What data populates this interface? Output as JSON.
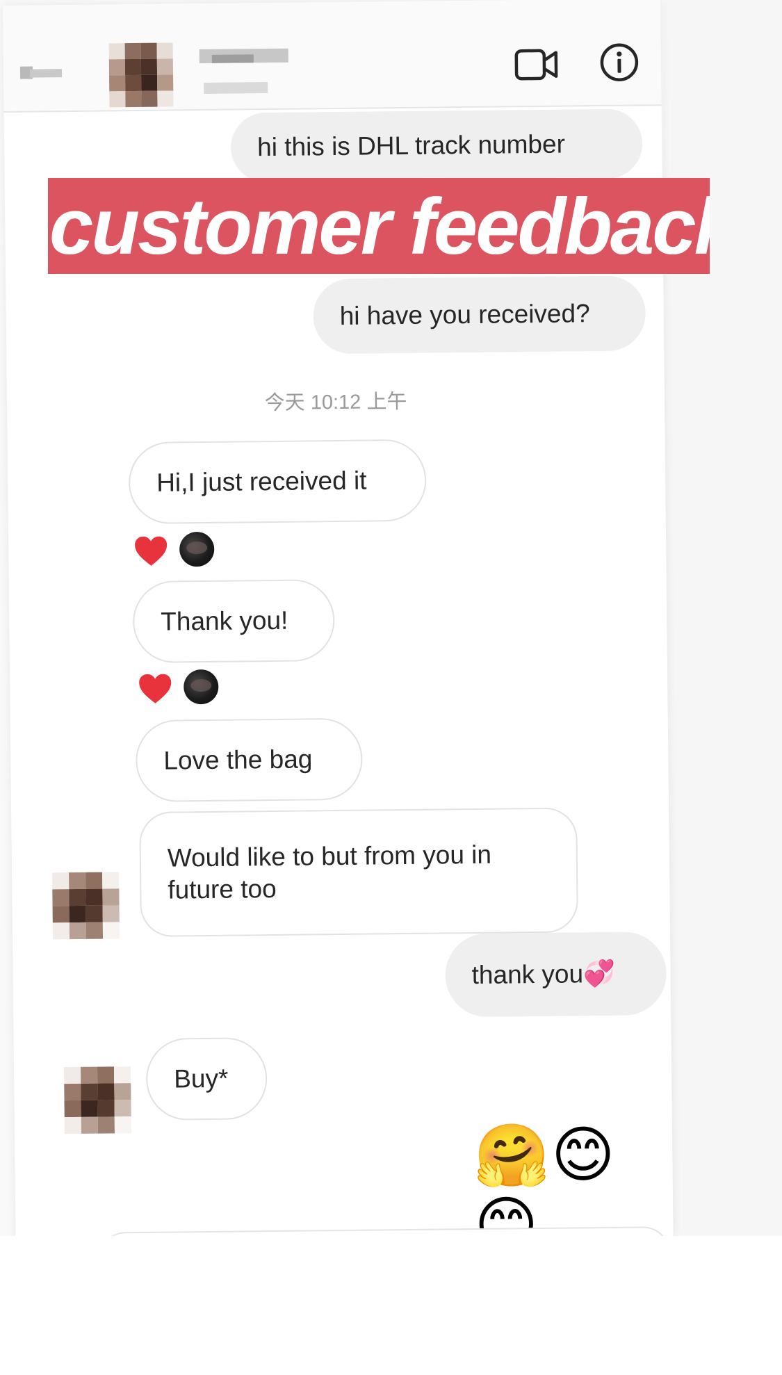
{
  "header": {
    "back_icon": "back-arrow-icon",
    "video_icon": "video-camera-icon",
    "info_icon": "info-icon"
  },
  "banner": {
    "text": "customer feedback",
    "background": "#db5460"
  },
  "messages": [
    {
      "direction": "outgoing",
      "text": "hi this is DHL track number"
    },
    {
      "direction": "outgoing",
      "text": "hi have you received?"
    },
    {
      "direction": "incoming",
      "text": "Hi,I just received it",
      "reaction": "heart-icon"
    },
    {
      "direction": "incoming",
      "text": "Thank you!",
      "reaction": "heart-icon"
    },
    {
      "direction": "incoming",
      "text": "Love the bag"
    },
    {
      "direction": "incoming",
      "text": "Would like to but from you in future too"
    },
    {
      "direction": "outgoing",
      "text": "thank you💞"
    },
    {
      "direction": "incoming",
      "text": "Buy*"
    },
    {
      "direction": "outgoing",
      "text": "🤗😊😊"
    }
  ],
  "timestamp": "今天 10:12 上午",
  "colors": {
    "outgoing_bubble": "#efefef",
    "incoming_border": "#e2e2e2",
    "heart": "#e8323c"
  }
}
